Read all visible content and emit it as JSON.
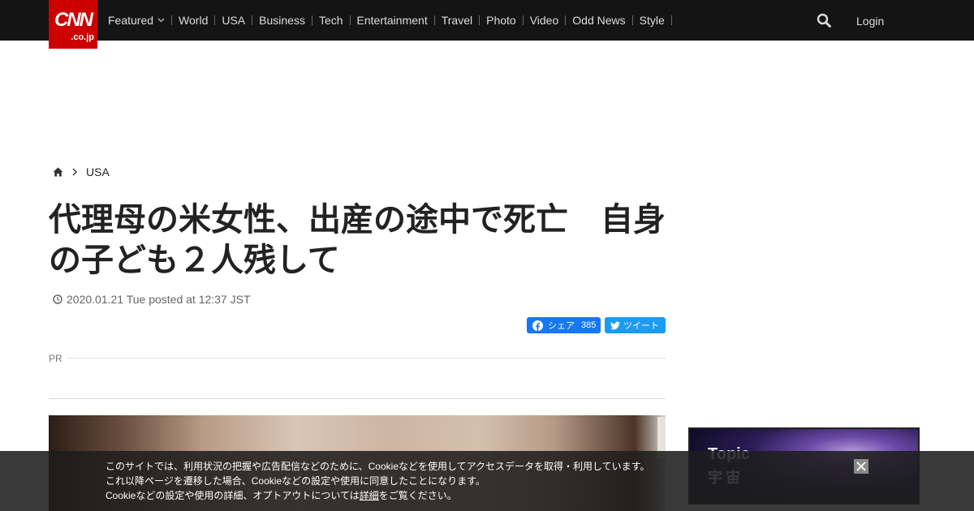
{
  "header": {
    "logo_main": "CNN",
    "logo_sub": ".co.jp",
    "nav": [
      {
        "label": "Featured",
        "has_dropdown": true
      },
      {
        "label": "World"
      },
      {
        "label": "USA"
      },
      {
        "label": "Business"
      },
      {
        "label": "Tech"
      },
      {
        "label": "Entertainment"
      },
      {
        "label": "Travel"
      },
      {
        "label": "Photo"
      },
      {
        "label": "Video"
      },
      {
        "label": "Odd News"
      },
      {
        "label": "Style"
      }
    ],
    "login_label": "Login",
    "icons": {
      "search": "search-icon",
      "dropdown": "chevron-down-icon"
    }
  },
  "breadcrumb": {
    "home_icon": "home-icon",
    "section": "USA"
  },
  "article": {
    "title": "代理母の米女性、出産の途中で死亡　自身の子ども２人残して",
    "posted": "2020.01.21 Tue posted at 12:37 JST",
    "share": {
      "facebook_label": "シェア",
      "facebook_count": "385",
      "twitter_label": "ツイート"
    },
    "pr_label": "PR"
  },
  "sidebar": {
    "topic_title": "Topic",
    "topic_sub": "宇宙"
  },
  "cookie": {
    "line1": "このサイトでは、利用状況の把握や広告配信などのために、Cookieなどを使用してアクセスデータを取得・利用しています。",
    "line2": "これ以降ページを遷移した場合、Cookieなどの設定や使用に同意したことになります。",
    "line3_pre": "Cookieなどの設定や使用の詳細、オプトアウトについては",
    "line3_link": "詳細",
    "line3_post": "をご覧ください。"
  },
  "colors": {
    "nav_bg": "#141414",
    "logo_red": "#cc0000",
    "facebook_blue": "#1877f2",
    "twitter_blue": "#1d9bf0"
  }
}
